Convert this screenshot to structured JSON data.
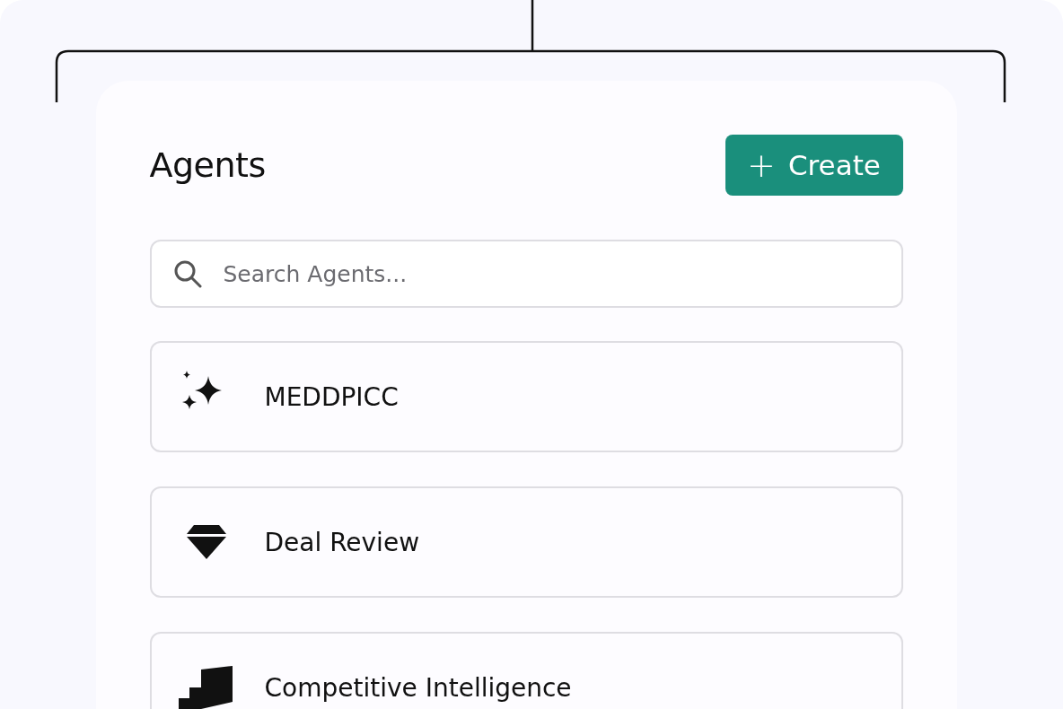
{
  "header": {
    "title": "Agents",
    "create_button": {
      "icon": "+",
      "label": "Create"
    }
  },
  "search": {
    "placeholder": "Search Agents..."
  },
  "agents": [
    {
      "name": "MEDDPICC",
      "kind": "sparkles"
    },
    {
      "name": "Deal Review",
      "kind": "gem"
    },
    {
      "name": "Competitive Intelligence",
      "kind": "stairs"
    }
  ]
}
